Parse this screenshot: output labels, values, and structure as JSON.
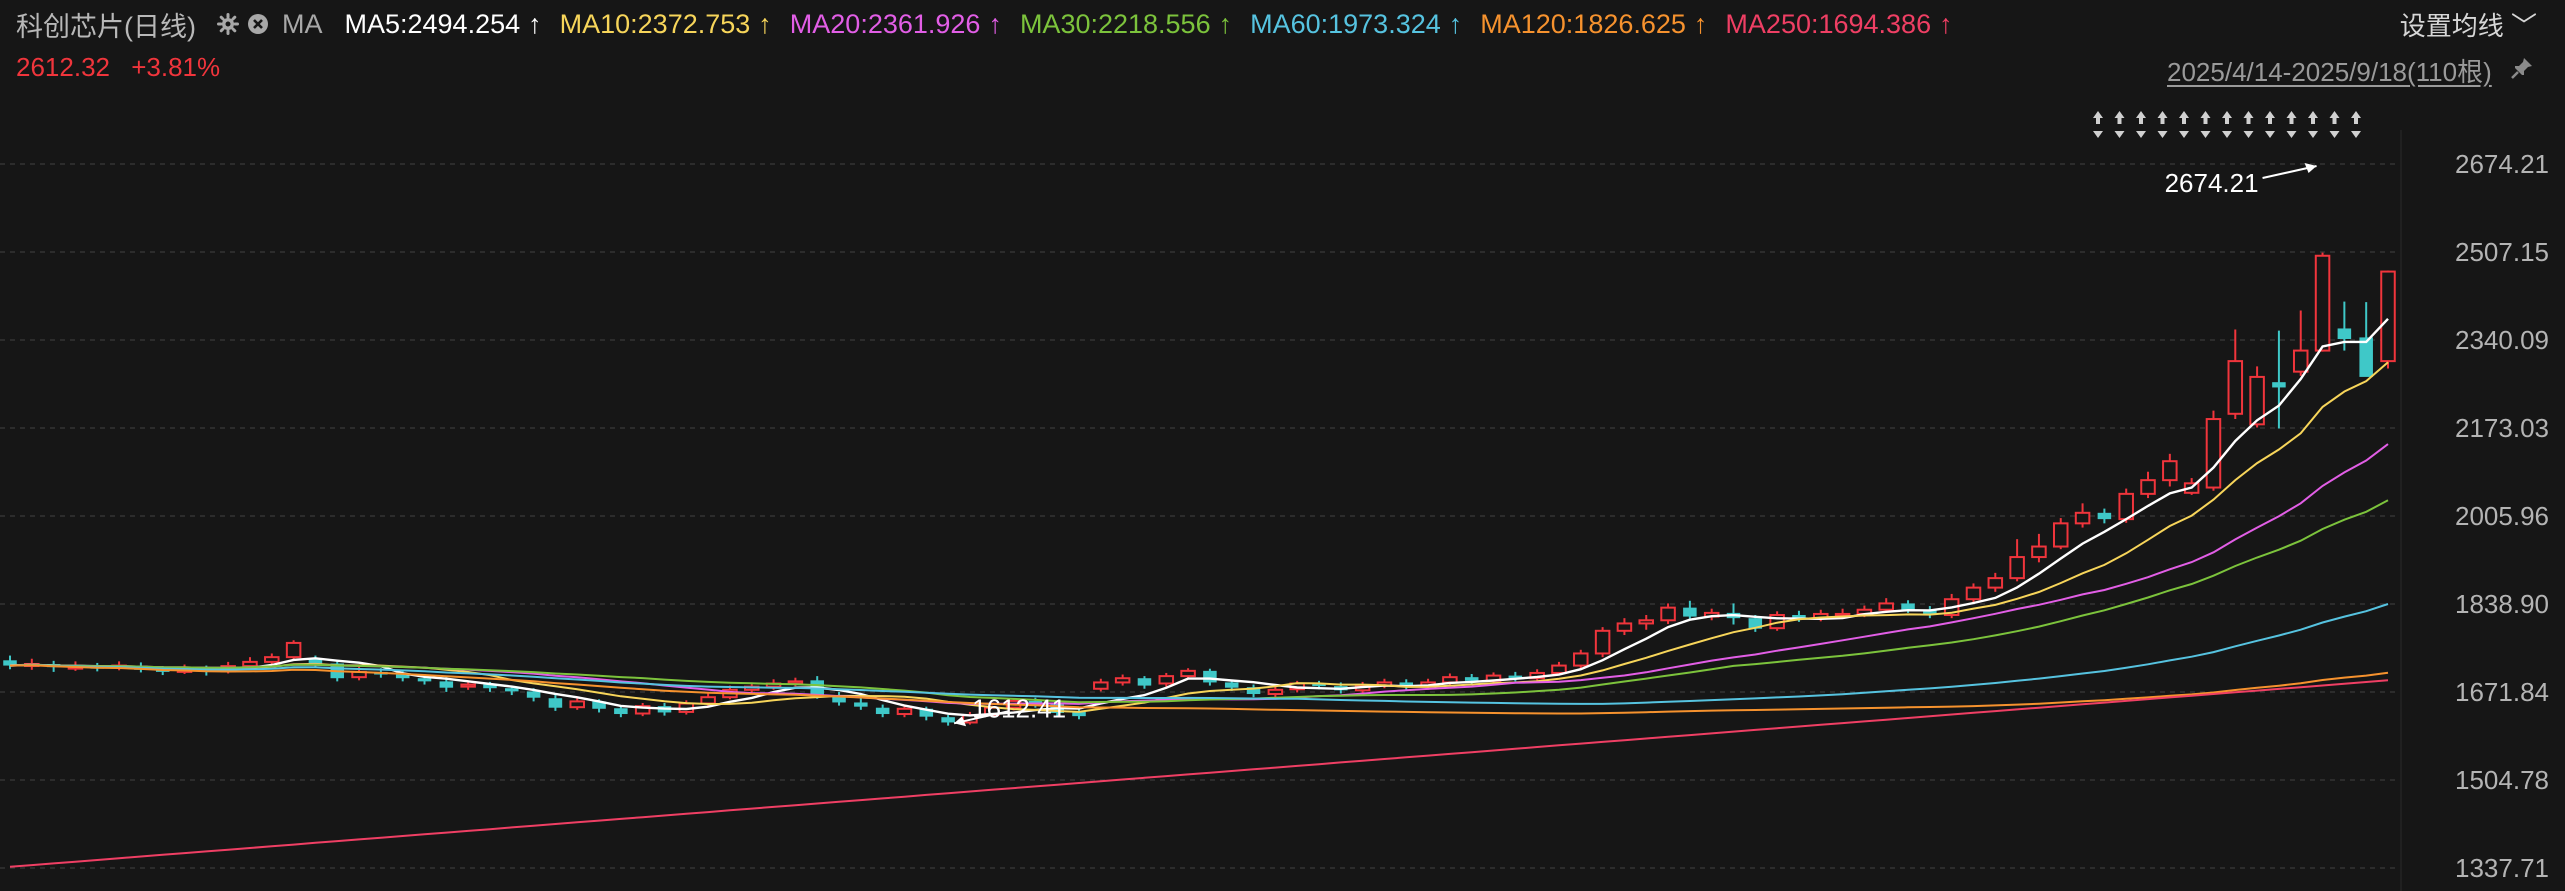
{
  "header": {
    "title": "科创芯片(日线)",
    "ma_label": "MA",
    "gear_icon": "gear-icon",
    "close_icon": "close-icon",
    "settings_label": "设置均线",
    "settings_icon": "chevron-down-icon",
    "date_range": "2025/4/14-2025/9/18(110根)",
    "pin_icon": "pin-icon"
  },
  "quote": {
    "price": "2612.32",
    "change": "+3.81%"
  },
  "ma_indicators": [
    {
      "label": "MA5:2494.254",
      "arrow": "↑",
      "color": "#ffffff"
    },
    {
      "label": "MA10:2372.753",
      "arrow": "↑",
      "color": "#f7d55a"
    },
    {
      "label": "MA20:2361.926",
      "arrow": "↑",
      "color": "#e25ee6"
    },
    {
      "label": "MA30:2218.556",
      "arrow": "↑",
      "color": "#7cc33c"
    },
    {
      "label": "MA60:1973.324",
      "arrow": "↑",
      "color": "#56c3e0"
    },
    {
      "label": "MA120:1826.625",
      "arrow": "↑",
      "color": "#f6922e"
    },
    {
      "label": "MA250:1694.386",
      "arrow": "↑",
      "color": "#ef3f64"
    }
  ],
  "chart_data": {
    "type": "candlestick",
    "title": "科创芯片(日线)",
    "x_range": [
      "2025/4/14",
      "2025/9/18"
    ],
    "bar_count": 110,
    "y_ticks": [
      "2674.21",
      "2507.15",
      "2340.09",
      "2173.03",
      "2005.96",
      "1838.90",
      "1671.84",
      "1504.78",
      "1337.71"
    ],
    "ylim": [
      1337.71,
      2674.21
    ],
    "grid": true,
    "high_annotation": "2674.21",
    "low_annotation": "1612.41",
    "up_color": "#f0353c",
    "down_color": "#3fc8c8",
    "candles": [
      [
        1732,
        1722,
        1741,
        1715
      ],
      [
        1722,
        1725,
        1735,
        1714
      ],
      [
        1725,
        1719,
        1731,
        1710
      ],
      [
        1719,
        1720,
        1730,
        1712
      ],
      [
        1720,
        1718,
        1727,
        1711
      ],
      [
        1718,
        1722,
        1730,
        1713
      ],
      [
        1722,
        1714,
        1728,
        1709
      ],
      [
        1714,
        1710,
        1721,
        1704
      ],
      [
        1710,
        1716,
        1724,
        1706
      ],
      [
        1716,
        1711,
        1722,
        1703
      ],
      [
        1711,
        1721,
        1729,
        1707
      ],
      [
        1721,
        1729,
        1738,
        1717
      ],
      [
        1729,
        1738,
        1745,
        1724
      ],
      [
        1738,
        1765,
        1770,
        1732
      ],
      [
        1735,
        1726,
        1741,
        1718
      ],
      [
        1726,
        1698,
        1731,
        1692
      ],
      [
        1700,
        1710,
        1720,
        1694
      ],
      [
        1710,
        1705,
        1717,
        1699
      ],
      [
        1705,
        1698,
        1712,
        1692
      ],
      [
        1698,
        1692,
        1706,
        1686
      ],
      [
        1692,
        1680,
        1700,
        1672
      ],
      [
        1682,
        1686,
        1693,
        1676
      ],
      [
        1686,
        1679,
        1691,
        1672
      ],
      [
        1679,
        1673,
        1684,
        1666
      ],
      [
        1673,
        1661,
        1679,
        1654
      ],
      [
        1660,
        1642,
        1666,
        1636
      ],
      [
        1643,
        1654,
        1660,
        1638
      ],
      [
        1654,
        1640,
        1658,
        1633
      ],
      [
        1641,
        1630,
        1646,
        1624
      ],
      [
        1631,
        1645,
        1651,
        1626
      ],
      [
        1645,
        1633,
        1651,
        1627
      ],
      [
        1634,
        1650,
        1656,
        1629
      ],
      [
        1650,
        1662,
        1670,
        1645
      ],
      [
        1662,
        1676,
        1684,
        1658
      ],
      [
        1676,
        1682,
        1690,
        1671
      ],
      [
        1682,
        1688,
        1696,
        1676
      ],
      [
        1688,
        1692,
        1699,
        1683
      ],
      [
        1694,
        1664,
        1702,
        1659
      ],
      [
        1665,
        1652,
        1672,
        1646
      ],
      [
        1652,
        1644,
        1660,
        1638
      ],
      [
        1642,
        1630,
        1648,
        1624
      ],
      [
        1630,
        1640,
        1646,
        1624
      ],
      [
        1640,
        1625,
        1644,
        1618
      ],
      [
        1624,
        1614,
        1628,
        1608
      ],
      [
        1614,
        1628,
        1634,
        1610
      ],
      [
        1628,
        1642,
        1646,
        1624
      ],
      [
        1642,
        1655,
        1660,
        1637
      ],
      [
        1655,
        1648,
        1661,
        1642
      ],
      [
        1648,
        1632,
        1652,
        1626
      ],
      [
        1634,
        1626,
        1641,
        1620
      ],
      [
        1678,
        1690,
        1697,
        1673
      ],
      [
        1690,
        1698,
        1705,
        1684
      ],
      [
        1698,
        1684,
        1702,
        1678
      ],
      [
        1688,
        1702,
        1708,
        1682
      ],
      [
        1702,
        1712,
        1717,
        1696
      ],
      [
        1712,
        1690,
        1716,
        1684
      ],
      [
        1690,
        1680,
        1694,
        1674
      ],
      [
        1681,
        1668,
        1686,
        1662
      ],
      [
        1668,
        1676,
        1682,
        1662
      ],
      [
        1677,
        1688,
        1693,
        1671
      ],
      [
        1688,
        1683,
        1693,
        1677
      ],
      [
        1683,
        1675,
        1690,
        1669
      ],
      [
        1675,
        1684,
        1691,
        1668
      ],
      [
        1684,
        1690,
        1697,
        1679
      ],
      [
        1690,
        1682,
        1696,
        1676
      ],
      [
        1682,
        1690,
        1697,
        1676
      ],
      [
        1690,
        1700,
        1707,
        1685
      ],
      [
        1700,
        1693,
        1706,
        1687
      ],
      [
        1693,
        1703,
        1709,
        1687
      ],
      [
        1703,
        1698,
        1710,
        1692
      ],
      [
        1698,
        1708,
        1715,
        1692
      ],
      [
        1708,
        1722,
        1729,
        1703
      ],
      [
        1722,
        1745,
        1752,
        1716
      ],
      [
        1745,
        1788,
        1795,
        1738
      ],
      [
        1788,
        1802,
        1812,
        1780
      ],
      [
        1802,
        1808,
        1818,
        1790
      ],
      [
        1808,
        1832,
        1840,
        1801
      ],
      [
        1832,
        1815,
        1845,
        1808
      ],
      [
        1815,
        1822,
        1830,
        1808
      ],
      [
        1822,
        1812,
        1840,
        1800
      ],
      [
        1812,
        1792,
        1818,
        1786
      ],
      [
        1793,
        1818,
        1825,
        1788
      ],
      [
        1818,
        1812,
        1826,
        1805
      ],
      [
        1812,
        1820,
        1828,
        1806
      ],
      [
        1820,
        1820,
        1830,
        1812
      ],
      [
        1820,
        1828,
        1836,
        1814
      ],
      [
        1828,
        1840,
        1850,
        1822
      ],
      [
        1840,
        1828,
        1846,
        1822
      ],
      [
        1828,
        1818,
        1835,
        1812
      ],
      [
        1818,
        1848,
        1858,
        1812
      ],
      [
        1848,
        1870,
        1878,
        1842
      ],
      [
        1870,
        1888,
        1898,
        1862
      ],
      [
        1888,
        1928,
        1962,
        1882
      ],
      [
        1928,
        1948,
        1972,
        1918
      ],
      [
        1948,
        1992,
        2002,
        1943
      ],
      [
        1992,
        2012,
        2030,
        1984
      ],
      [
        2012,
        2000,
        2020,
        1992
      ],
      [
        2000,
        2048,
        2058,
        1993
      ],
      [
        2048,
        2074,
        2090,
        2040
      ],
      [
        2074,
        2110,
        2124,
        2062
      ],
      [
        2050,
        2068,
        2078,
        2046
      ],
      [
        2060,
        2190,
        2206,
        2054
      ],
      [
        2200,
        2300,
        2360,
        2190
      ],
      [
        2180,
        2270,
        2290,
        2174
      ],
      [
        2260,
        2250,
        2358,
        2172
      ],
      [
        2280,
        2320,
        2396,
        2272
      ],
      [
        2320,
        2500,
        2506,
        2318
      ],
      [
        2362,
        2342,
        2413,
        2320
      ],
      [
        2345,
        2270,
        2412,
        2318
      ],
      [
        2300,
        2470,
        2472,
        2286
      ]
    ]
  }
}
